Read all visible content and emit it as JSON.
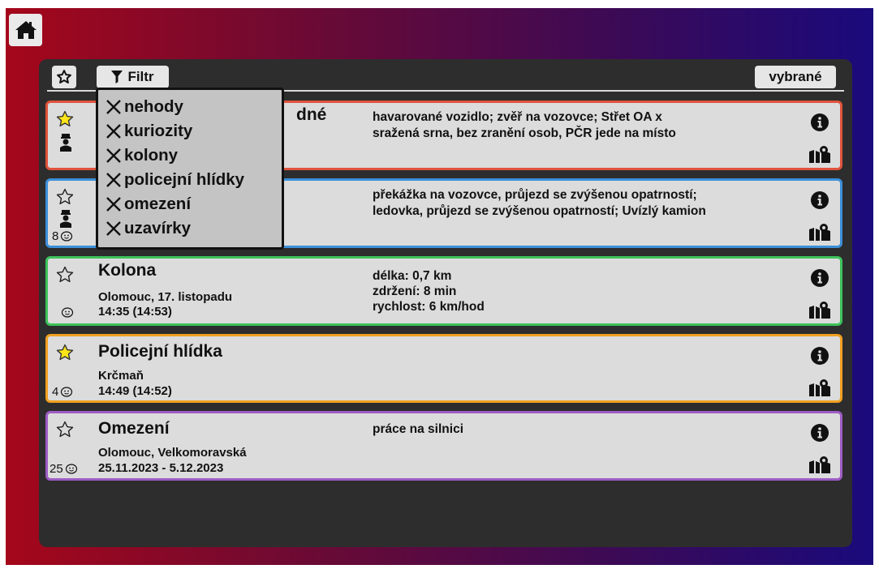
{
  "toolbar": {
    "filter_label": "Filtr",
    "selected_label": "vybrané"
  },
  "filter": {
    "items": [
      {
        "label": "nehody",
        "checked": true
      },
      {
        "label": "kuriozity",
        "checked": true
      },
      {
        "label": "kolony",
        "checked": true
      },
      {
        "label": "policejní hlídky",
        "checked": true
      },
      {
        "label": "omezení",
        "checked": true
      },
      {
        "label": "uzavírky",
        "checked": true
      }
    ]
  },
  "cards": [
    {
      "title_visible_fragment": "dné",
      "description": [
        "havarované vozidlo; zvěř na vozovce; Střet OA x",
        "sražená srna, bez zranění osob, PČR jede na místo"
      ],
      "starred": true,
      "border_color": "#e0533c"
    },
    {
      "description": [
        "překážka na vozovce, průjezd se zvýšenou opatrností;",
        "ledovka, průjezd se zvýšenou opatrností; Uvízlý kamion"
      ],
      "waze_count": "8",
      "starred": false,
      "border_color": "#3b8fd9"
    },
    {
      "title": "Kolona",
      "location": "Olomouc, 17. listopadu",
      "time": "14:35 (14:53)",
      "description": [
        "délka: 0,7 km",
        "zdržení: 8 min",
        "rychlost: 6 km/hod"
      ],
      "starred": false,
      "border_color": "#3cc25a"
    },
    {
      "title": "Policejní hlídka",
      "location": "Krčmaň",
      "time": "14:49 (14:52)",
      "waze_count": "4",
      "starred": true,
      "border_color": "#f0a020"
    },
    {
      "title": "Omezení",
      "location": "Olomouc, Velkomoravská",
      "time": "25.11.2023 - 5.12.2023",
      "description": [
        "práce na silnici"
      ],
      "waze_count": "25",
      "starred": false,
      "border_color": "#9d5cc4"
    }
  ],
  "colors": {
    "star_filled": "#ffe51a",
    "panel": "#2d2d2d",
    "card_bg": "#dcdcdc"
  }
}
